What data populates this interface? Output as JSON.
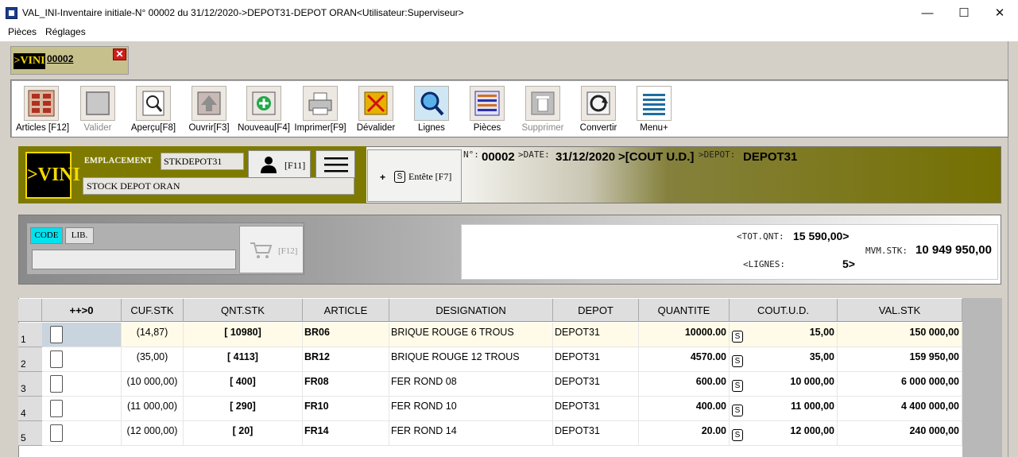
{
  "window": {
    "title": "VAL_INI-Inventaire initiale-N° 00002 du 31/12/2020->DEPOT31-DEPOT ORAN<Utilisateur:Superviseur>",
    "minimize": "—",
    "maximize": "☐",
    "close": "✕"
  },
  "menu": [
    "Pièces",
    "Réglages"
  ],
  "doc_tab": {
    "logo": ">VINI",
    "label": "00002",
    "close": "✕"
  },
  "toolbar": [
    {
      "label": "Articles [F12]",
      "icon": "articles-icon",
      "enabled": true
    },
    {
      "label": "Valider",
      "icon": "validate-icon",
      "enabled": false
    },
    {
      "label": "Aperçu[F8]",
      "icon": "preview-icon",
      "enabled": true
    },
    {
      "label": "Ouvrir[F3]",
      "icon": "open-icon",
      "enabled": true
    },
    {
      "label": "Nouveau[F4]",
      "icon": "new-icon",
      "enabled": true
    },
    {
      "label": "Imprimer[F9]",
      "icon": "print-icon",
      "enabled": true
    },
    {
      "label": "Dévalider",
      "icon": "devalidate-icon",
      "enabled": true
    },
    {
      "label": "Lignes",
      "icon": "search-lines-icon",
      "enabled": true
    },
    {
      "label": "Pièces",
      "icon": "pieces-icon",
      "enabled": true
    },
    {
      "label": "Supprimer",
      "icon": "trash-icon",
      "enabled": false
    },
    {
      "label": "Convertir",
      "icon": "convert-icon",
      "enabled": true
    },
    {
      "label": "Menu+",
      "icon": "menu-icon",
      "enabled": true
    }
  ],
  "location": {
    "logo": ">VINI",
    "label": "EMPLACEMENT",
    "code": "STKDEPOT31",
    "name": "STOCK DEPOT ORAN",
    "user_key": "[F11]",
    "entete_plus": "+",
    "entete_s": "S",
    "entete_label": "Entête [F7]"
  },
  "header": {
    "n_label": "N°:",
    "n_value": "00002",
    "date_label": ">DATE:",
    "date_value": "31/12/2020",
    "cost_value": ">[COUT U.D.]",
    "depot_label": ">DEPOT:",
    "depot_value": "DEPOT31"
  },
  "search": {
    "code_btn": "CODE",
    "lib_btn": "LIB.",
    "input_value": "",
    "f12_label": "[F12]"
  },
  "totals": {
    "tot_qnt_label": "<TOT.QNT:",
    "tot_qnt_value": "15 590,00>",
    "lignes_label": "<LIGNES:",
    "lignes_value": "5>",
    "mvm_label": "MVM.STK:",
    "mvm_value": "10 949 950,00"
  },
  "table": {
    "headers": [
      "++>0",
      "CUF.STK",
      "QNT.STK",
      "ARTICLE",
      "DESIGNATION",
      "DEPOT",
      "QUANTITE",
      "COUT.U.D.",
      "VAL.STK"
    ],
    "rows": [
      {
        "n": "1",
        "cuf": "(14,87)",
        "qnt": "[ 10980]",
        "article": "BR06",
        "designation": "BRIQUE ROUGE 6 TROUS",
        "depot": "DEPOT31",
        "quantite": "10000.00",
        "s": "S",
        "cout": "15,00",
        "val": "150 000,00"
      },
      {
        "n": "2",
        "cuf": "(35,00)",
        "qnt": "[ 4113]",
        "article": "BR12",
        "designation": "BRIQUE ROUGE 12 TROUS",
        "depot": "DEPOT31",
        "quantite": "4570.00",
        "s": "S",
        "cout": "35,00",
        "val": "159 950,00"
      },
      {
        "n": "3",
        "cuf": "(10 000,00)",
        "qnt": "[ 400]",
        "article": "FR08",
        "designation": "FER ROND 08",
        "depot": "DEPOT31",
        "quantite": "600.00",
        "s": "S",
        "cout": "10 000,00",
        "val": "6 000 000,00"
      },
      {
        "n": "4",
        "cuf": "(11 000,00)",
        "qnt": "[ 290]",
        "article": "FR10",
        "designation": "FER ROND 10",
        "depot": "DEPOT31",
        "quantite": "400.00",
        "s": "S",
        "cout": "11 000,00",
        "val": "4 400 000,00"
      },
      {
        "n": "5",
        "cuf": "(12 000,00)",
        "qnt": "[ 20]",
        "article": "FR14",
        "designation": "FER ROND 14",
        "depot": "DEPOT31",
        "quantite": "20.00",
        "s": "S",
        "cout": "12 000,00",
        "val": "240 000,00"
      }
    ]
  }
}
